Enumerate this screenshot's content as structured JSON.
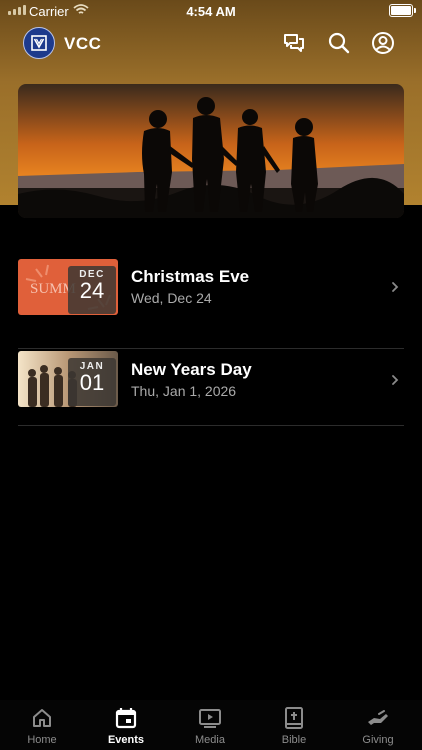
{
  "status_bar": {
    "carrier": "Carrier",
    "time": "4:54 AM"
  },
  "app_bar": {
    "title": "VCC",
    "icons": [
      "chat-icon",
      "search-icon",
      "profile-icon"
    ]
  },
  "events": [
    {
      "month": "DEC",
      "day": "24",
      "title": "Christmas Eve",
      "date": "Wed, Dec 24",
      "thumb_text": "SUMM"
    },
    {
      "month": "JAN",
      "day": "01",
      "title": "New Years Day",
      "date": "Thu, Jan 1, 2026"
    }
  ],
  "tabs": [
    {
      "label": "Home",
      "icon": "home-icon"
    },
    {
      "label": "Events",
      "icon": "calendar-icon",
      "active": true
    },
    {
      "label": "Media",
      "icon": "media-icon"
    },
    {
      "label": "Bible",
      "icon": "bible-icon"
    },
    {
      "label": "Giving",
      "icon": "giving-icon"
    }
  ],
  "colors": {
    "header": "#9a6f2a",
    "logo": "#1d3a8c",
    "background": "#000000"
  }
}
